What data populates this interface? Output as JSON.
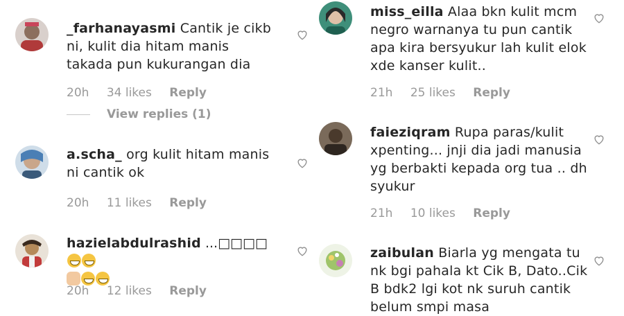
{
  "comments_left": [
    {
      "username": "_farhanayasmi",
      "text": " Cantik je cikb ni, kulit dia hitam manis takada pun kukurangan dia",
      "time": "20h",
      "likes": "34 likes",
      "reply": "Reply",
      "view_replies": "View replies (1)",
      "avatar_color": "#8c6f5e"
    },
    {
      "username": "a.scha_",
      "text": " org kulit hitam manis ni cantik ok",
      "time": "20h",
      "likes": "11 likes",
      "reply": "Reply",
      "avatar_color": "#4a7fb5"
    },
    {
      "username": "hazielabdulrashid",
      "text": " ...□□□□",
      "time": "20h",
      "likes": "12 likes",
      "reply": "Reply",
      "avatar_color": "#b58a5a"
    }
  ],
  "comments_right": [
    {
      "username": "miss_eilla",
      "text": " Alaa bkn kulit mcm negro warnanya tu pun cantik apa kira bersyukur lah kulit elok xde kanser kulit..",
      "time": "21h",
      "likes": "25 likes",
      "reply": "Reply",
      "avatar_color": "#3f8f7a"
    },
    {
      "username": "faieziqram",
      "text": " Rupa paras/kulit xpenting... jnji dia jadi manusia yg berbakti kepada org tua .. dh syukur",
      "time": "21h",
      "likes": "10 likes",
      "reply": "Reply",
      "avatar_color": "#5a4a3c"
    },
    {
      "username": "zaibulan",
      "text": " Biarla yg mengata tu nk bgi pahala kt Cik B, Dato..Cik B bdk2 lgi kot nk suruh cantik belum smpi masa",
      "avatar_color": "#9fc46a"
    }
  ],
  "colors": {
    "text": "#262626",
    "meta": "#999999",
    "heart_stroke": "#8e8e8e"
  },
  "icons": {
    "like": "heart-outline-icon",
    "emoji": "grinning-face-emoji-icon"
  }
}
